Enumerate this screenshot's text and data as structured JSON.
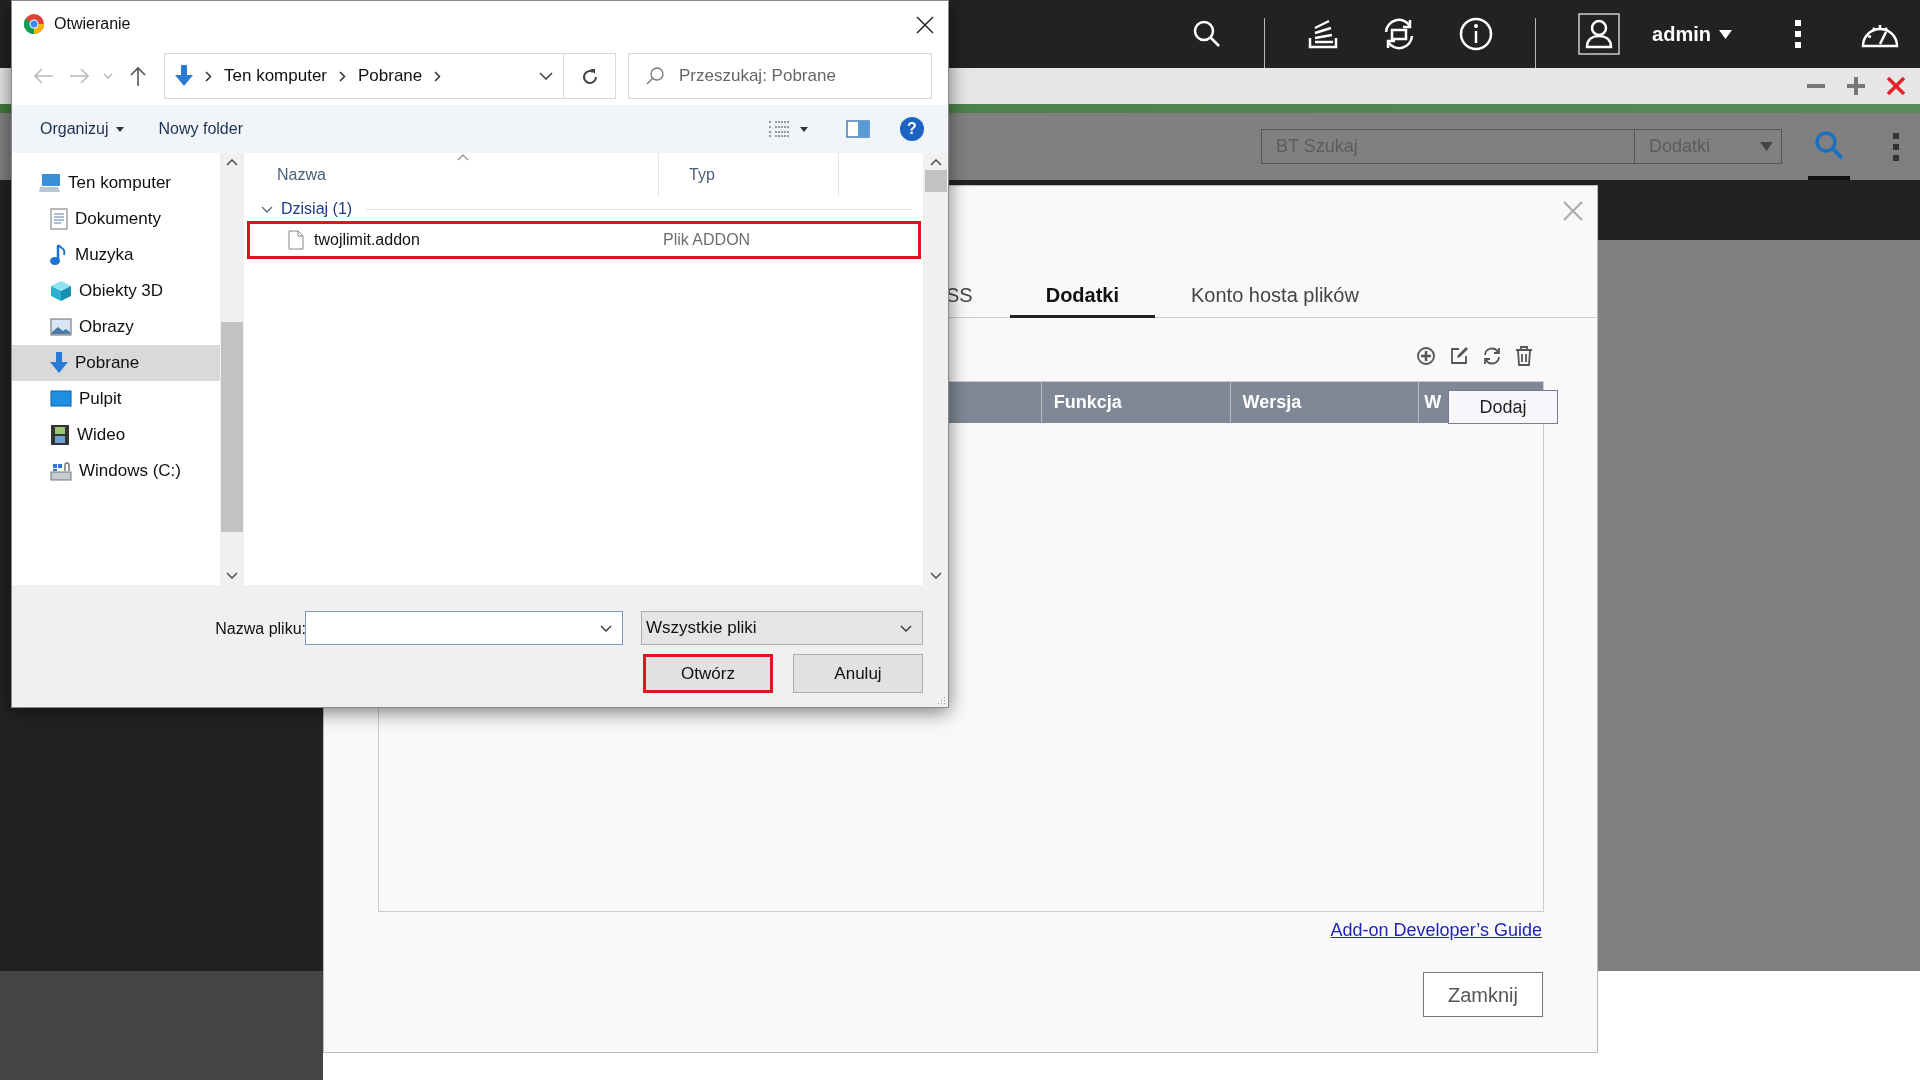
{
  "top_bar": {
    "user": "admin"
  },
  "app_toolbar": {
    "search_placeholder": "BT Szukaj",
    "category": "Dodatki"
  },
  "modal": {
    "tabs": [
      {
        "label": "SS",
        "selected": false
      },
      {
        "label": "Dodatki",
        "selected": true
      },
      {
        "label": "Konto hosta plików",
        "selected": false
      }
    ],
    "table": {
      "columns": [
        "Funkcja",
        "Wersja",
        "W"
      ]
    },
    "tooltip": "Dodaj",
    "link": "Add-on Developer’s Guide",
    "close_button": "Zamknij"
  },
  "file_dialog": {
    "title": "Otwieranie",
    "breadcrumb": [
      "Ten komputer",
      "Pobrane"
    ],
    "search_placeholder": "Przeszukaj: Pobrane",
    "toolbar": [
      "Organizuj",
      "Nowy folder"
    ],
    "help": "?",
    "nav": [
      {
        "label": "Ten komputer",
        "kind": "computer",
        "selected": false,
        "children": [
          {
            "label": "Dokumenty",
            "kind": "documents",
            "selected": false
          },
          {
            "label": "Muzyka",
            "kind": "music",
            "selected": false
          },
          {
            "label": "Obiekty 3D",
            "kind": "objects",
            "selected": false
          },
          {
            "label": "Obrazy",
            "kind": "pictures",
            "selected": false
          },
          {
            "label": "Pobrane",
            "kind": "downloads",
            "selected": true
          },
          {
            "label": "Pulpit",
            "kind": "desktop",
            "selected": false
          },
          {
            "label": "Wideo",
            "kind": "video",
            "selected": false
          },
          {
            "label": "Windows (C:)",
            "kind": "drive",
            "selected": false
          }
        ]
      }
    ],
    "columns": [
      "Nazwa",
      "Typ"
    ],
    "group": "Dzisiaj (1)",
    "files": [
      {
        "name": "twojlimit.addon",
        "type": "Plik ADDON",
        "highlighted": true
      }
    ],
    "filename_label": "Nazwa pliku:",
    "filter": "Wszystkie pliki",
    "buttons": [
      {
        "label": "Otwórz",
        "highlighted": true
      },
      {
        "label": "Anuluj",
        "highlighted": false
      }
    ]
  }
}
